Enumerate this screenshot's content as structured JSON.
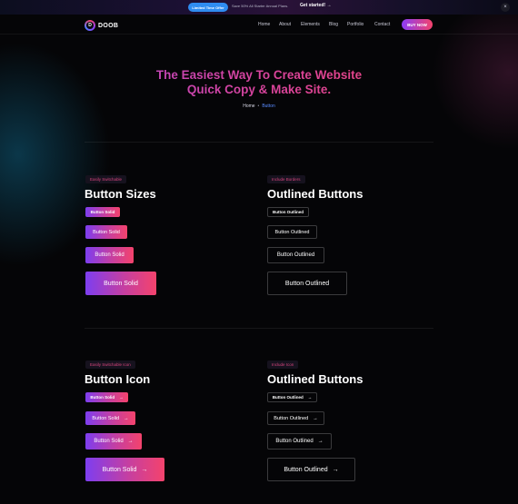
{
  "promo": {
    "badge": "Limited Time Offer",
    "offer": "Save 50% All Starter Annual Plans.",
    "cta": "Get started! →",
    "close_icon": "close-icon",
    "close_glyph": "×"
  },
  "header": {
    "logo_letter": "D",
    "logo_text": "DOOB",
    "nav": [
      "Home",
      "About",
      "Elements",
      "Blog",
      "Portfolio",
      "Contact"
    ],
    "buy_label": "BUY NOW"
  },
  "hero": {
    "title_line1": "The Easiest Way To Create Website",
    "title_line2": "Quick Copy & Make Site.",
    "breadcrumb_home": "Home",
    "breadcrumb_sep": "•",
    "breadcrumb_current": "Button"
  },
  "sections": {
    "sizes": {
      "tag": "Easily Switchable",
      "title": "Button Sizes",
      "buttons": [
        "Button Solid",
        "Button Solid",
        "Button Solid",
        "Button Solid"
      ]
    },
    "outlined": {
      "tag": "Include Borders",
      "title": "Outlined Buttons",
      "buttons": [
        "Button Outlined",
        "Button Outlined",
        "Button Outlined",
        "Button Outlined"
      ]
    },
    "icon": {
      "tag": "Easily Switchable Icon",
      "title": "Button Icon",
      "buttons": [
        "Button Solid",
        "Button Solid",
        "Button Solid",
        "Button Solid"
      ],
      "arrow": "→"
    },
    "outlined_icon": {
      "tag": "Include Icon",
      "title": "Outlined Buttons",
      "buttons": [
        "Button Outlined",
        "Button Outlined",
        "Button Outlined",
        "Button Outlined"
      ],
      "arrow": "→"
    }
  },
  "colors": {
    "accent_start": "#7d3ef0",
    "accent_end": "#f4436c",
    "tag_text": "#d8457e",
    "breadcrumb_active": "#5a8cff"
  }
}
